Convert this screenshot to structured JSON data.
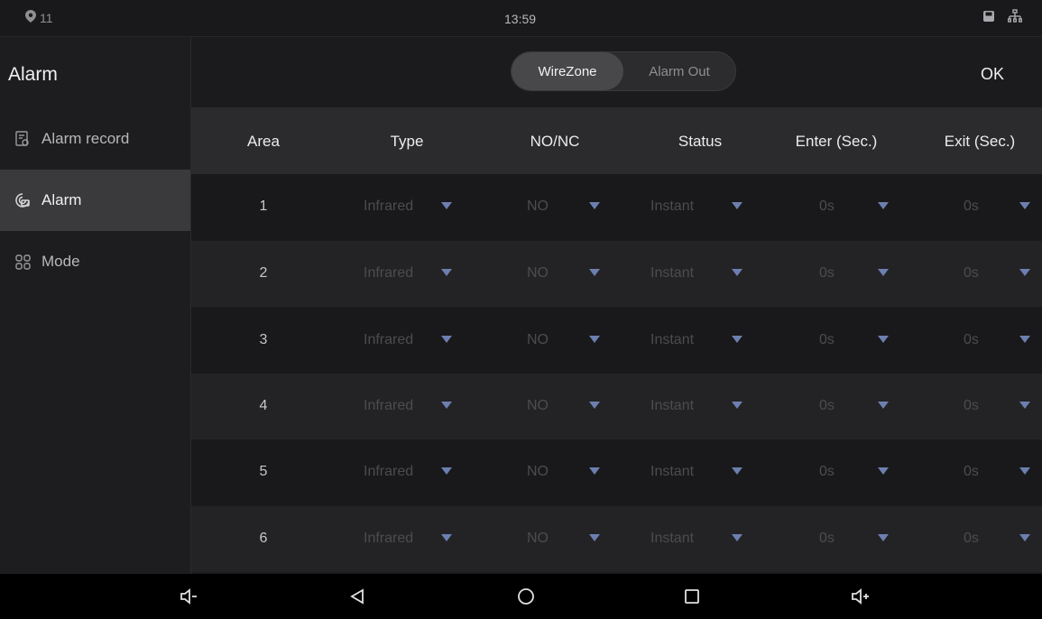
{
  "statusbar": {
    "notification_count": "11",
    "time": "13:59",
    "icons": [
      "location-icon",
      "sd-card-icon",
      "network-icon"
    ]
  },
  "sidebar": {
    "title": "Alarm",
    "items": [
      {
        "label": "Alarm record",
        "icon": "alarm-record-icon",
        "active": false
      },
      {
        "label": "Alarm",
        "icon": "alarm-icon",
        "active": true
      },
      {
        "label": "Mode",
        "icon": "mode-grid-icon",
        "active": false
      }
    ]
  },
  "header": {
    "tabs": [
      {
        "label": "WireZone",
        "active": true
      },
      {
        "label": "Alarm Out",
        "active": false
      }
    ],
    "ok_label": "OK"
  },
  "table": {
    "columns": [
      "Area",
      "Type",
      "NO/NC",
      "Status",
      "Enter (Sec.)",
      "Exit (Sec.)"
    ],
    "rows": [
      {
        "area": "1",
        "type": "Infrared",
        "nonc": "NO",
        "status": "Instant",
        "enter": "0s",
        "exit": "0s"
      },
      {
        "area": "2",
        "type": "Infrared",
        "nonc": "NO",
        "status": "Instant",
        "enter": "0s",
        "exit": "0s"
      },
      {
        "area": "3",
        "type": "Infrared",
        "nonc": "NO",
        "status": "Instant",
        "enter": "0s",
        "exit": "0s"
      },
      {
        "area": "4",
        "type": "Infrared",
        "nonc": "NO",
        "status": "Instant",
        "enter": "0s",
        "exit": "0s"
      },
      {
        "area": "5",
        "type": "Infrared",
        "nonc": "NO",
        "status": "Instant",
        "enter": "0s",
        "exit": "0s"
      },
      {
        "area": "6",
        "type": "Infrared",
        "nonc": "NO",
        "status": "Instant",
        "enter": "0s",
        "exit": "0s"
      }
    ]
  },
  "navbar": {
    "buttons": [
      "volume-down-icon",
      "back-icon",
      "home-icon",
      "recents-icon",
      "volume-up-icon"
    ]
  },
  "colors": {
    "background": "#1b1b1d",
    "active_item": "#3a3a3d",
    "caret": "#6d7fb0",
    "disabled_text": "#4c4c50"
  }
}
